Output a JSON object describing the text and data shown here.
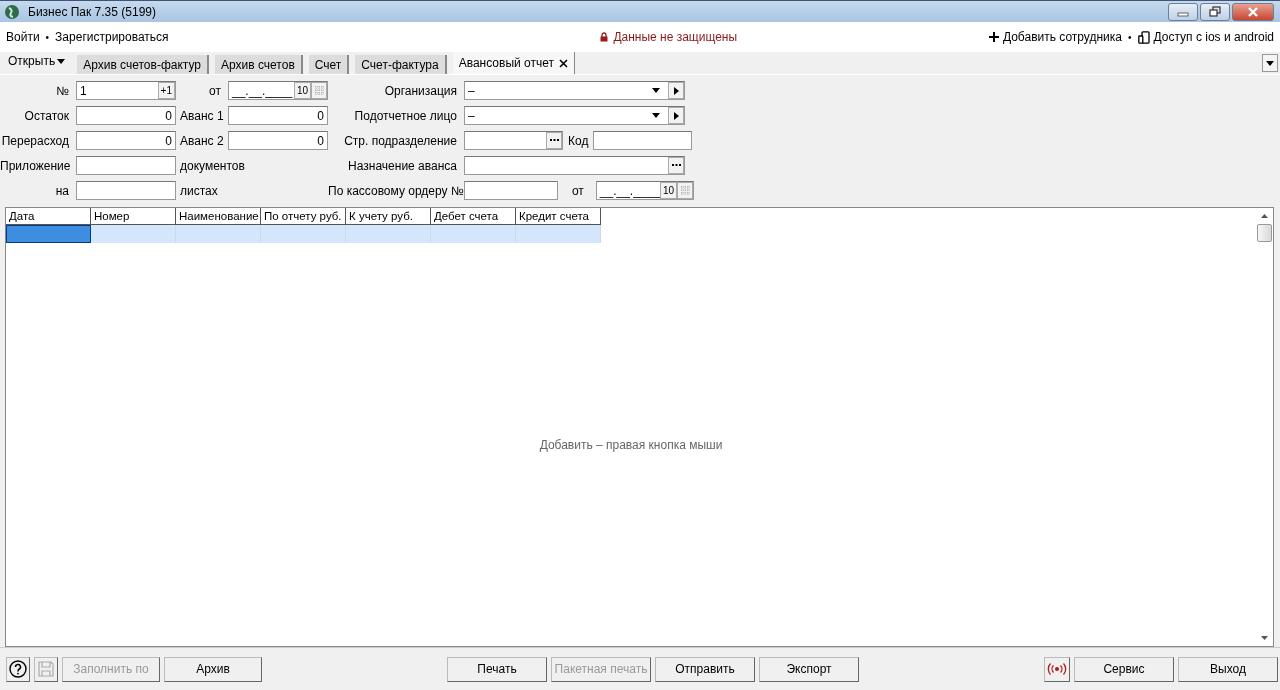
{
  "window": {
    "title": "Бизнес Пак 7.35 (5199)"
  },
  "top_links": {
    "left": [
      "Войти",
      "Зарегистрироваться"
    ],
    "separator": "•",
    "security": "Данные не защищены",
    "right": [
      "Добавить сотрудника",
      "Доступ с ios и android"
    ]
  },
  "tabs": {
    "open_menu": "Открыть",
    "items": [
      {
        "label": "Архив счетов-фактур",
        "selected": false
      },
      {
        "label": "Архив счетов",
        "selected": false
      },
      {
        "label": "Счет",
        "selected": false
      },
      {
        "label": "Счет-фактура",
        "selected": false
      },
      {
        "label": "Авансовый отчет",
        "selected": true
      }
    ]
  },
  "form": {
    "number": {
      "label": "№",
      "value": "1",
      "increment": "+1"
    },
    "date": {
      "label": "от",
      "value": "__.__.____",
      "calendar": "10"
    },
    "organization": {
      "label": "Организация",
      "value": "–"
    },
    "balance": {
      "label": "Остаток",
      "value": "0"
    },
    "advance_1": {
      "label": "Аванс 1",
      "value": "0"
    },
    "accountable_person": {
      "label": "Подотчетное лицо",
      "value": "–"
    },
    "overspend": {
      "label": "Перерасход",
      "value": "0"
    },
    "advance_2": {
      "label": "Аванс 2",
      "value": "0"
    },
    "division": {
      "label": "Стр. подразделение"
    },
    "code": {
      "label": "Код"
    },
    "attachment": {
      "label": "Приложение",
      "suffix": "документов"
    },
    "purpose": {
      "label": "Назначение аванса"
    },
    "sheets": {
      "label": "на",
      "suffix": "листах"
    },
    "cash_order": {
      "label": "По кассовому ордеру №"
    },
    "cash_order_date": {
      "label": "от",
      "value": "__.__.____",
      "calendar": "10"
    }
  },
  "table": {
    "columns": [
      "Дата",
      "Номер",
      "Наименование",
      "По отчету руб.",
      "К учету руб.",
      "Дебет счета",
      "Кредит счета"
    ],
    "rows": [
      {
        "cells": [
          {
            "selected": true
          },
          {
            "selected": false
          },
          {
            "selected": false
          },
          {
            "selected": false
          },
          {
            "selected": false
          },
          {
            "selected": false
          },
          {
            "selected": false
          }
        ]
      }
    ],
    "hint": "Добавить – правая кнопка мыши"
  },
  "bottom_bar": {
    "left": [
      {
        "kind": "help",
        "disabled": false
      },
      {
        "kind": "save",
        "disabled": true
      },
      {
        "kind": "text",
        "label": "Заполнить по",
        "disabled": true
      },
      {
        "kind": "text",
        "label": "Архив",
        "disabled": false
      }
    ],
    "center": [
      {
        "kind": "text",
        "label": "Печать",
        "disabled": false
      },
      {
        "kind": "text",
        "label": "Пакетная печать",
        "disabled": true
      },
      {
        "kind": "text",
        "label": "Отправить",
        "disabled": false
      },
      {
        "kind": "text",
        "label": "Экспорт",
        "disabled": false
      }
    ],
    "right": [
      {
        "kind": "signal",
        "disabled": false
      },
      {
        "kind": "text",
        "label": "Сервис",
        "disabled": false
      },
      {
        "kind": "text",
        "label": "Выход",
        "disabled": false
      }
    ]
  }
}
